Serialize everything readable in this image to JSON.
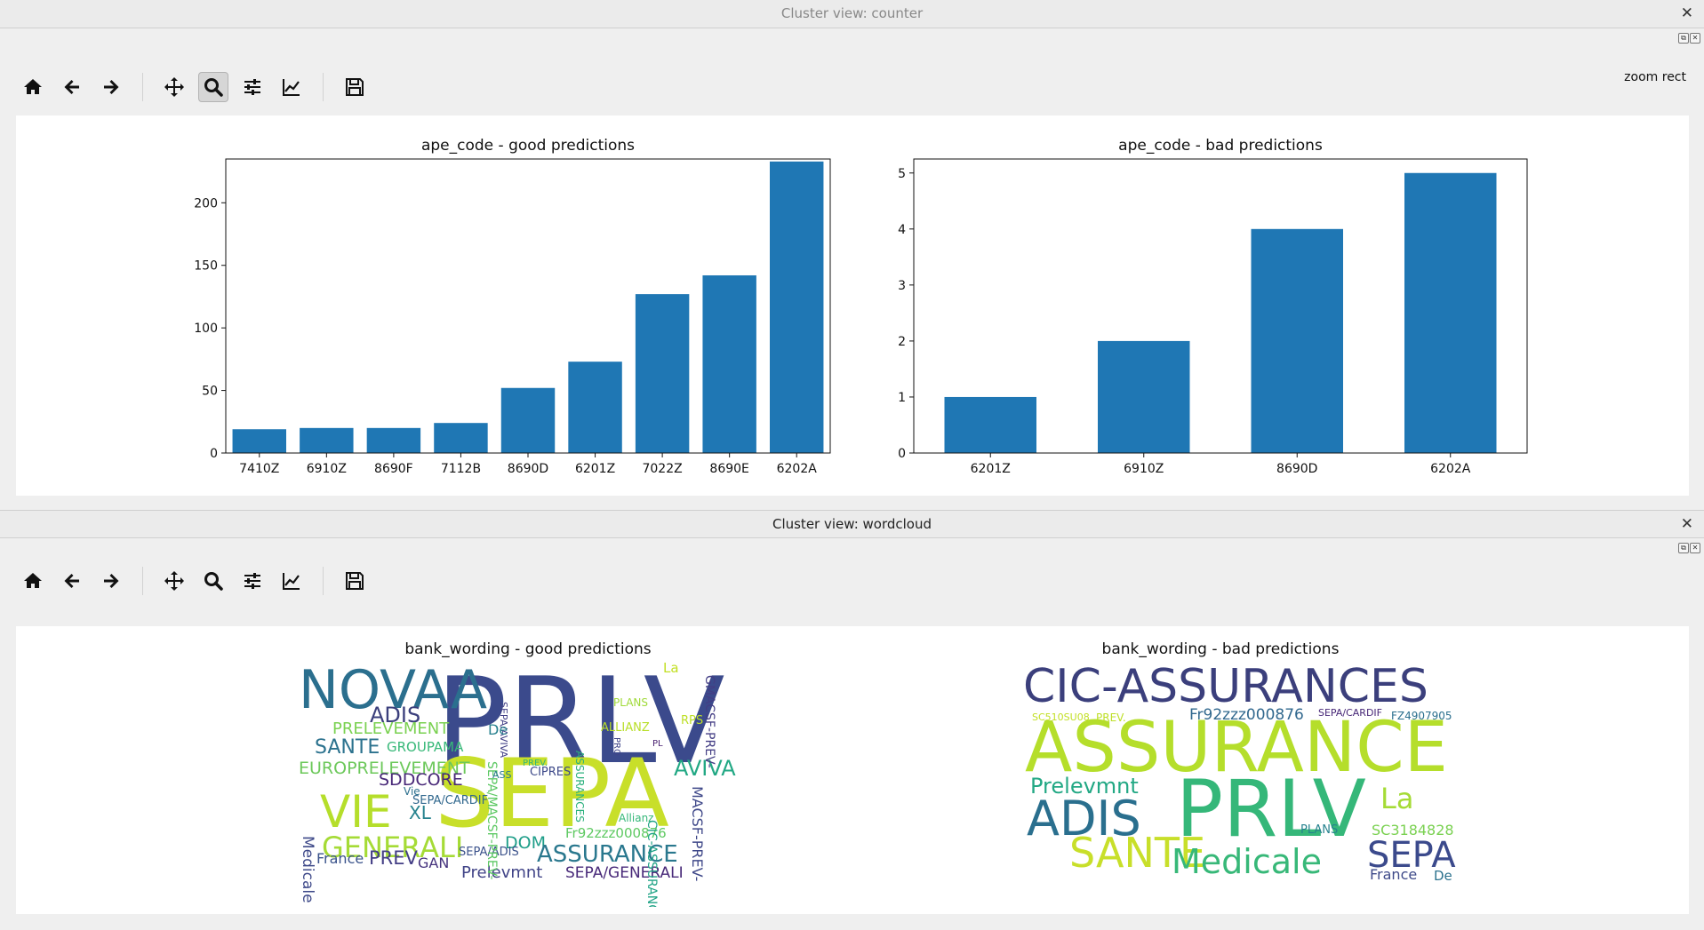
{
  "windows": {
    "counter": {
      "title": "Cluster view: counter",
      "close": "✕",
      "dock": [
        "⧉",
        "✕"
      ],
      "status": "zoom rect"
    },
    "wordcloud": {
      "title": "Cluster view: wordcloud",
      "close": "✕",
      "dock": [
        "⧉",
        "✕"
      ]
    }
  },
  "toolbar_icons": [
    "home-icon",
    "back-arrow-icon",
    "forward-arrow-icon",
    "pan-move-icon",
    "zoom-magnifier-icon",
    "subplots-sliders-icon",
    "edit-curves-icon",
    "save-floppy-icon"
  ],
  "colors": {
    "bar": "#1f77b4"
  },
  "chart_data": [
    {
      "type": "bar",
      "title": "ape_code - good predictions",
      "categories": [
        "7410Z",
        "6910Z",
        "8690F",
        "7112B",
        "8690D",
        "6201Z",
        "7022Z",
        "8690E",
        "6202A"
      ],
      "values": [
        19,
        20,
        20,
        24,
        52,
        73,
        127,
        142,
        233
      ],
      "ylim": [
        0,
        235
      ],
      "yticks": [
        0,
        50,
        100,
        150,
        200
      ],
      "xlabel": "",
      "ylabel": ""
    },
    {
      "type": "bar",
      "title": "ape_code - bad predictions",
      "categories": [
        "6201Z",
        "6910Z",
        "8690D",
        "6202A"
      ],
      "values": [
        1,
        2,
        4,
        5
      ],
      "ylim": [
        0,
        5.25
      ],
      "yticks": [
        0,
        1,
        2,
        3,
        4,
        5
      ],
      "xlabel": "",
      "ylabel": ""
    }
  ],
  "wordclouds": {
    "good": {
      "title": "bank_wording - good predictions",
      "words": [
        {
          "text": "PRLV",
          "color": "#3b4a8c"
        },
        {
          "text": "SEPA",
          "color": "#c8df2a"
        },
        {
          "text": "NOVAA",
          "color": "#2b6f8e"
        },
        {
          "text": "ADIS",
          "color": "#3b3f7c"
        },
        {
          "text": "PRELEVEMENT",
          "color": "#7ad151"
        },
        {
          "text": "SANTE",
          "color": "#2c728e"
        },
        {
          "text": "GROUPAMA",
          "color": "#37b878"
        },
        {
          "text": "EUROPRELEVEMENT",
          "color": "#6cc85a"
        },
        {
          "text": "SDDCORE",
          "color": "#482878"
        },
        {
          "text": "VIE",
          "color": "#b5de2b"
        },
        {
          "text": "XL",
          "color": "#26828e"
        },
        {
          "text": "GENERALI",
          "color": "#a5db36"
        },
        {
          "text": "DOM",
          "color": "#1f9e89"
        },
        {
          "text": "ASSURANCE",
          "color": "#2a788e"
        },
        {
          "text": "AVIVA",
          "color": "#22a884"
        },
        {
          "text": "CIPRES",
          "color": "#3e4a89"
        },
        {
          "text": "PREV",
          "color": "#433e85"
        },
        {
          "text": "GAN",
          "color": "#46337e"
        },
        {
          "text": "France",
          "color": "#3a538b"
        },
        {
          "text": "Prelevmnt",
          "color": "#404387"
        },
        {
          "text": "SEPA/GENERALI",
          "color": "#482979"
        },
        {
          "text": "SEPA/ADIS",
          "color": "#3b528b"
        },
        {
          "text": "Fr92zzz000876",
          "color": "#5ec962"
        },
        {
          "text": "SEPA/CARDIF",
          "color": "#31688e"
        },
        {
          "text": "Medicale",
          "color": "#3e4989"
        },
        {
          "text": "Vie",
          "color": "#2d708e"
        },
        {
          "text": "Allianz",
          "color": "#35b779"
        },
        {
          "text": "ALLIANZ",
          "color": "#b8de29"
        },
        {
          "text": "PLANS",
          "color": "#a0da39"
        },
        {
          "text": "RPS",
          "color": "#bddf26"
        },
        {
          "text": "PRO",
          "color": "#404588"
        },
        {
          "text": "ASSURANCES",
          "color": "#2cb17e"
        },
        {
          "text": "CIC-ASSURANCES",
          "color": "#20a386"
        },
        {
          "text": "MACSF-PREV-",
          "color": "#3f4889"
        },
        {
          "text": "GMACSF-PREV-",
          "color": "#433d84"
        },
        {
          "text": "SEPA/MACSF-PREV-",
          "color": "#5cc863"
        },
        {
          "text": "SEPA/AVIVA",
          "color": "#424086"
        },
        {
          "text": "De",
          "color": "#27808e"
        },
        {
          "text": "La",
          "color": "#c2df23"
        },
        {
          "text": "PL",
          "color": "#481f70"
        },
        {
          "text": "ASS",
          "color": "#29798e"
        },
        {
          "text": "PREV.",
          "color": "#32b67a"
        }
      ]
    },
    "bad": {
      "title": "bank_wording - bad predictions",
      "words": [
        {
          "text": "CIC-ASSURANCES",
          "color": "#3b3f7c"
        },
        {
          "text": "ASSURANCE",
          "color": "#b5de2b"
        },
        {
          "text": "PRLV",
          "color": "#35b779"
        },
        {
          "text": "ADIS",
          "color": "#2a6f8e"
        },
        {
          "text": "SANTE",
          "color": "#c8df2a"
        },
        {
          "text": "Medicale",
          "color": "#37b878"
        },
        {
          "text": "SEPA",
          "color": "#3b4a8c"
        },
        {
          "text": "La",
          "color": "#a5db36"
        },
        {
          "text": "Prelevmnt",
          "color": "#22a884"
        },
        {
          "text": "Fr92zzz000876",
          "color": "#31688e"
        },
        {
          "text": "SC3184828",
          "color": "#7ad151"
        },
        {
          "text": "PLANS",
          "color": "#26828e"
        },
        {
          "text": "France",
          "color": "#3e4a89"
        },
        {
          "text": "De",
          "color": "#2c728e"
        },
        {
          "text": "SEPA/CARDIF",
          "color": "#482878"
        },
        {
          "text": "FZ4907905",
          "color": "#2b6f8e"
        },
        {
          "text": "PREV.",
          "color": "#bddf26"
        },
        {
          "text": "SC510SU08",
          "color": "#c2df23"
        }
      ]
    }
  }
}
